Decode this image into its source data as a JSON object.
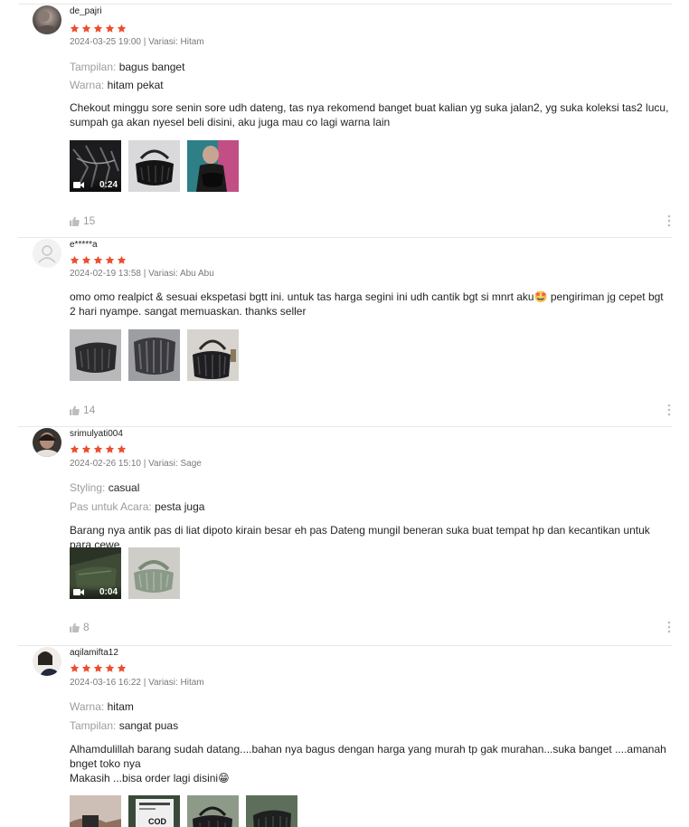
{
  "colors": {
    "star": "#ee4d2d",
    "muted": "#9e9e9e",
    "divider": "#e8e8e8"
  },
  "reviews": [
    {
      "username": "de_pajri",
      "rating": 5,
      "date": "2024-03-25 19:00",
      "variant_text": "Variasi: Hitam",
      "attributes": [
        {
          "label": "Tampilan:",
          "value": "bagus banget"
        },
        {
          "label": "Warna:",
          "value": "hitam pekat"
        }
      ],
      "comment": "Chekout minggu sore senin sore udh dateng, tas nya rekomend banget buat kalian yg suka jalan2, yg suka koleksi tas2 lucu, sumpah ga akan nyesel beli disini, aku juga mau co lagi warna lain",
      "media": [
        {
          "kind": "video",
          "duration": "0:24",
          "icon": "video-thumbnail"
        },
        {
          "kind": "image",
          "icon": "bag-photo"
        },
        {
          "kind": "image",
          "icon": "model-photo"
        }
      ],
      "likes": "15"
    },
    {
      "username": "e*****a",
      "rating": 5,
      "date": "2024-02-19 13:58",
      "variant_text": "Variasi: Abu Abu",
      "attributes": [],
      "comment": "omo omo realpict & sesuai ekspetasi bgtt ini. untuk tas harga segini ini udh cantik bgt si mnrt aku🤩 pengiriman jg cepet bgt 2 hari nyampe. sangat memuaskan. thanks seller",
      "media": [
        {
          "kind": "image",
          "icon": "bag-photo"
        },
        {
          "kind": "image",
          "icon": "bag-photo"
        },
        {
          "kind": "image",
          "icon": "bag-photo"
        }
      ],
      "likes": "14"
    },
    {
      "username": "srimulyati004",
      "rating": 5,
      "date": "2024-02-26 15:10",
      "variant_text": "Variasi: Sage",
      "attributes": [
        {
          "label": "Styling:",
          "value": "casual"
        },
        {
          "label": "Pas untuk Acara:",
          "value": "pesta juga"
        }
      ],
      "comment": "Barang nya antik pas di liat dipoto kirain besar eh pas Dateng mungil beneran suka buat tempat hp dan kecantikan untuk para cewe",
      "media": [
        {
          "kind": "video",
          "duration": "0:04",
          "icon": "video-thumbnail"
        },
        {
          "kind": "image",
          "icon": "bag-photo"
        }
      ],
      "likes": "8"
    },
    {
      "username": "aqilamifta12",
      "rating": 5,
      "date": "2024-03-16 16:22",
      "variant_text": "Variasi: Hitam",
      "attributes": [
        {
          "label": "Warna:",
          "value": "hitam"
        },
        {
          "label": "Tampilan:",
          "value": "sangat puas"
        }
      ],
      "comment": "Alhamdulillah barang sudah datang....bahan nya bagus dengan harga yang murah tp gak murahan...suka banget ....amanah bnget toko nya\nMakasih ...bisa order lagi disini😁",
      "media": [
        {
          "kind": "image",
          "icon": "package-photo"
        },
        {
          "kind": "image",
          "icon": "package-label-photo",
          "label": "COD"
        },
        {
          "kind": "image",
          "icon": "bag-photo"
        },
        {
          "kind": "image",
          "icon": "bag-photo"
        }
      ],
      "likes": ""
    }
  ]
}
